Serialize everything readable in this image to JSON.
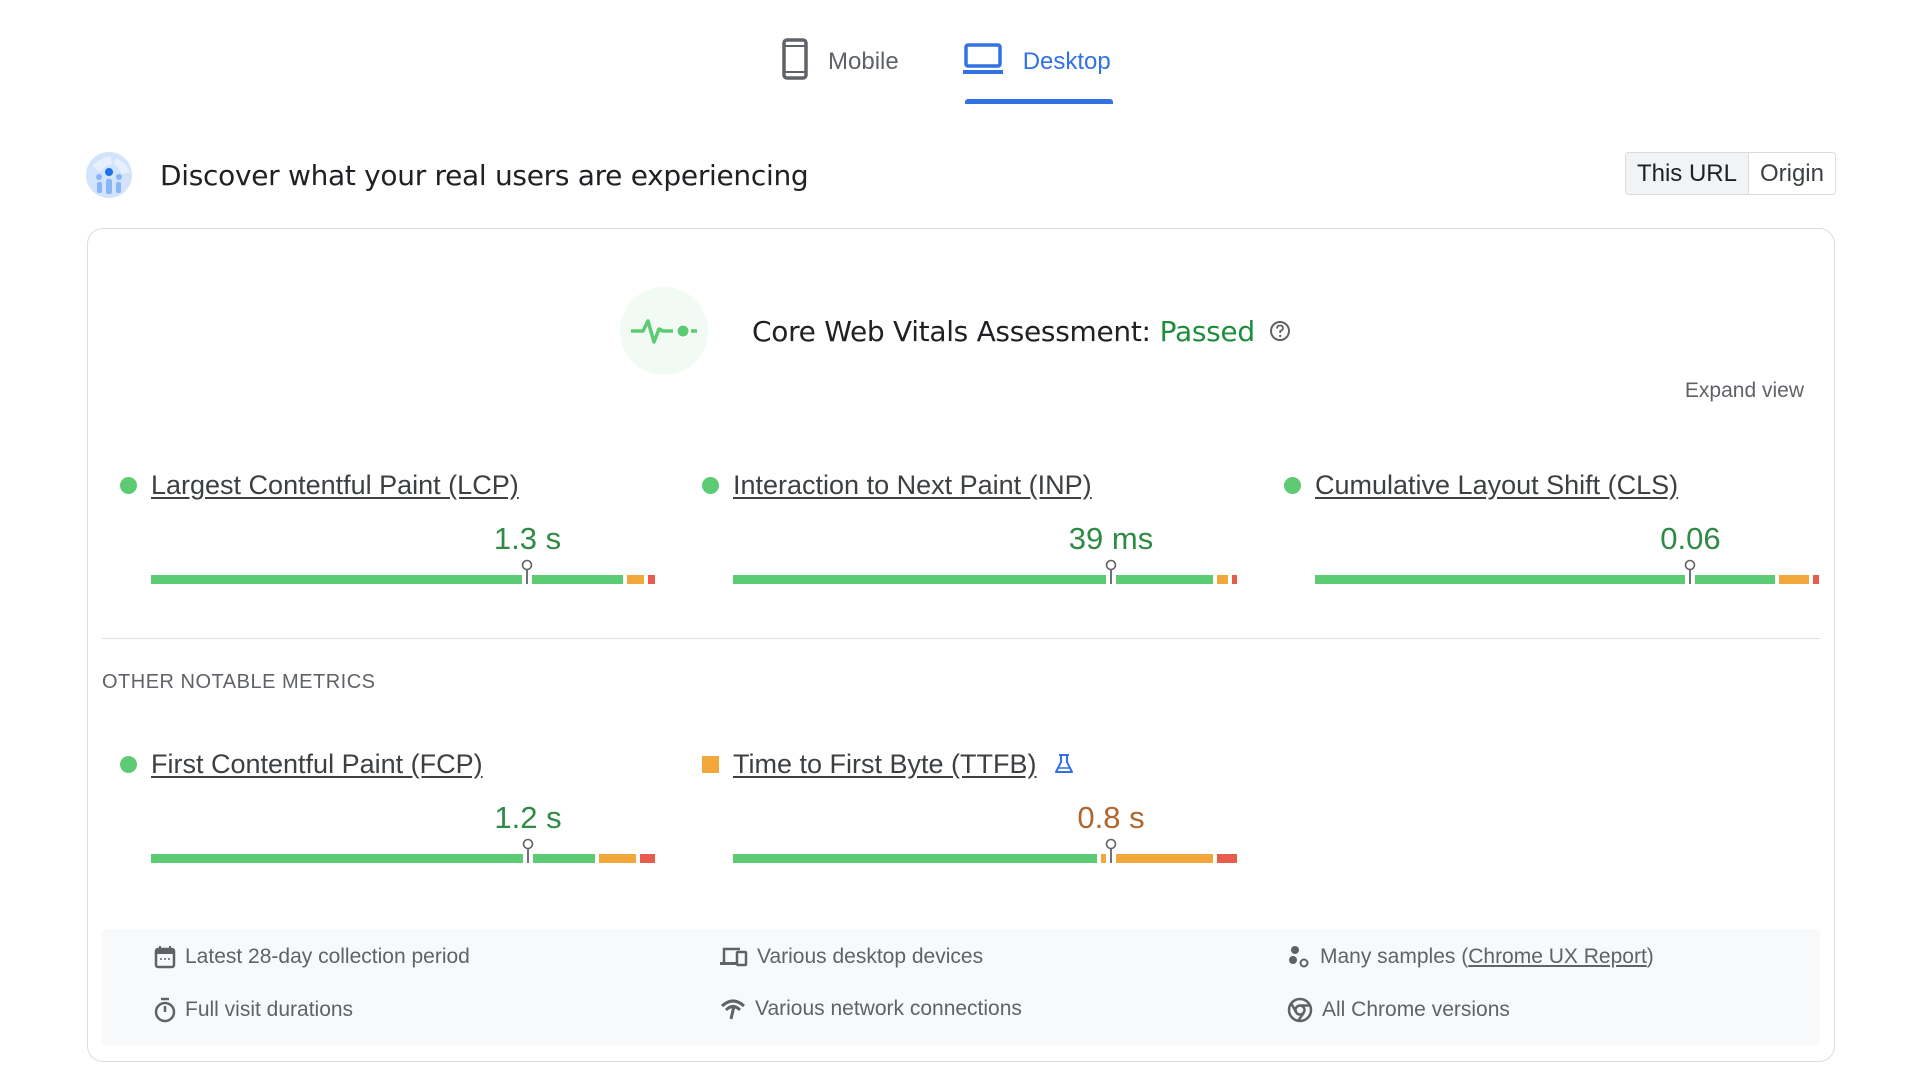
{
  "tabs": [
    {
      "label": "Mobile",
      "icon": "smartphone-icon",
      "active": false
    },
    {
      "label": "Desktop",
      "icon": "laptop-icon",
      "active": true
    }
  ],
  "header": {
    "title": "Discover what your real users are experiencing",
    "logo_icon": "crux-users-globe-icon",
    "scope_options": [
      "This URL",
      "Origin"
    ],
    "scope_selected": "This URL"
  },
  "assessment": {
    "label": "Core Web Vitals Assessment:",
    "status": "Passed",
    "status_color": "#1e8e3e",
    "icon": "heartbeat-icon",
    "help_icon": "help-circle-icon"
  },
  "expand_view_label": "Expand view",
  "core_metrics": [
    {
      "name": "Largest Contentful Paint (LCP)",
      "value": "1.3 s",
      "rating": "good",
      "distribution": {
        "good": 0.934,
        "needs_improvement": 0.034,
        "poor": 0.014
      },
      "percentile_marker": 0.747
    },
    {
      "name": "Interaction to Next Paint (INP)",
      "value": "39 ms",
      "rating": "good",
      "distribution": {
        "good": 0.956,
        "needs_improvement": 0.022,
        "poor": 0.01
      },
      "percentile_marker": 0.75
    },
    {
      "name": "Cumulative Layout Shift (CLS)",
      "value": "0.06",
      "rating": "good",
      "distribution": {
        "good": 0.913,
        "needs_improvement": 0.06,
        "poor": 0.012
      },
      "percentile_marker": 0.745
    }
  ],
  "other_section_label": "OTHER NOTABLE METRICS",
  "other_metrics": [
    {
      "name": "First Contentful Paint (FCP)",
      "value": "1.2 s",
      "rating": "good",
      "distribution": {
        "good": 0.884,
        "needs_improvement": 0.073,
        "poor": 0.03
      },
      "percentile_marker": 0.748
    },
    {
      "name": "Time to First Byte (TTFB)",
      "value": "0.8 s",
      "rating": "needs_improvement",
      "experimental_icon": "flask-icon",
      "distribution": {
        "good": 0.72,
        "needs_improvement": 0.22,
        "poor": 0.04
      },
      "percentile_marker": 0.75
    }
  ],
  "colors": {
    "good": "#5ccb74",
    "needs_improvement": "#f2a73b",
    "poor": "#e95b4d",
    "accent": "#3272e3"
  },
  "footer": {
    "items": [
      {
        "icon": "calendar-icon",
        "text": "Latest 28-day collection period"
      },
      {
        "icon": "devices-icon",
        "text": "Various desktop devices"
      },
      {
        "icon": "samples-icon",
        "text": "Many samples (",
        "link": "Chrome UX Report",
        "suffix": ")"
      },
      {
        "icon": "timer-icon",
        "text": "Full visit durations"
      },
      {
        "icon": "network-icon",
        "text": "Various network connections"
      },
      {
        "icon": "chrome-icon",
        "text": "All Chrome versions"
      }
    ]
  }
}
